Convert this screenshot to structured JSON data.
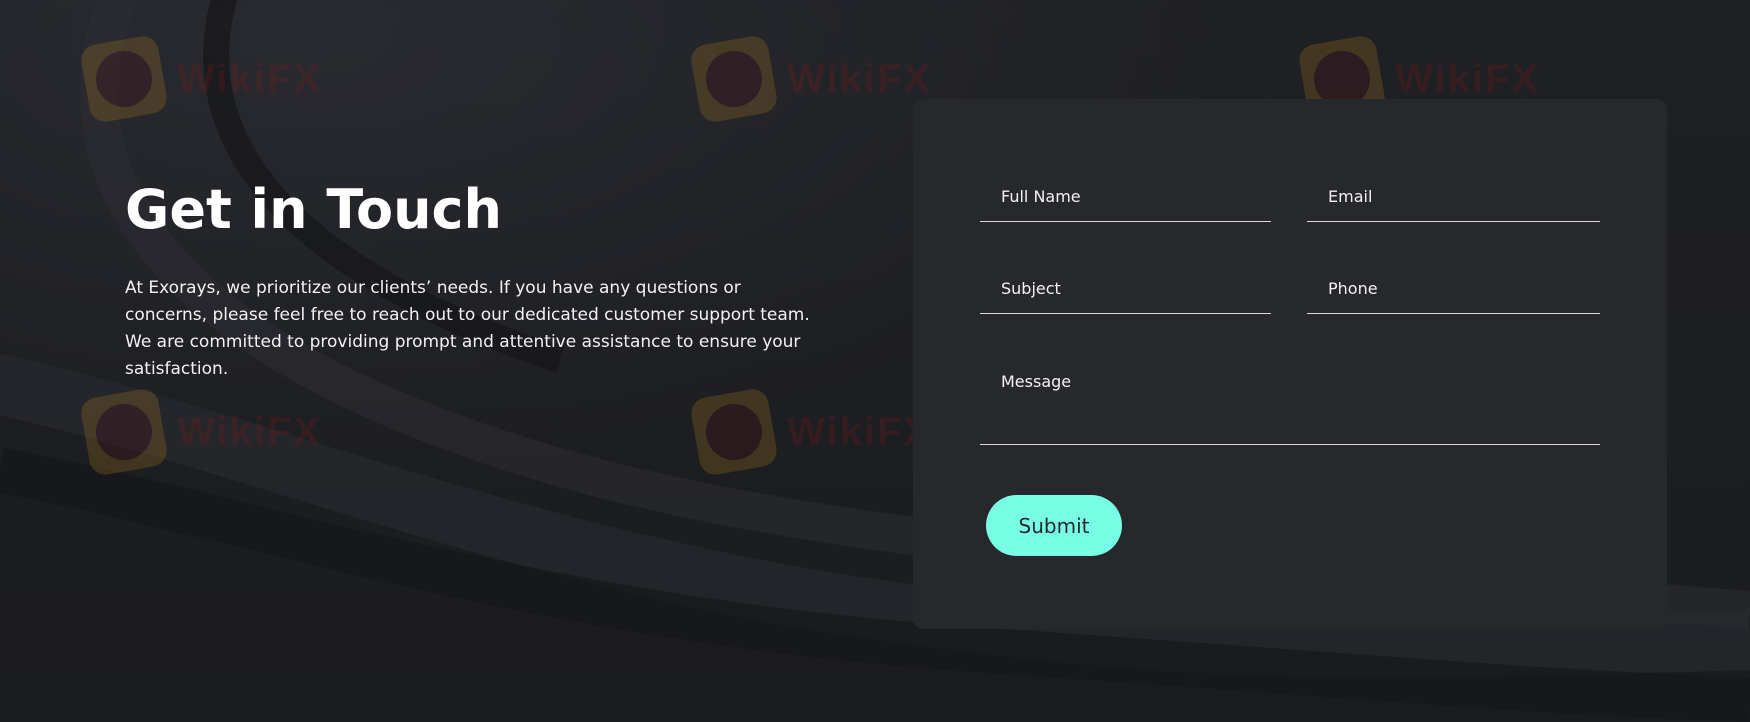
{
  "section": {
    "title": "Get in Touch",
    "description": "At Exorays, we prioritize our clients’ needs. If you have any questions or concerns, please feel free to reach out to our dedicated customer support team. We are committed to providing prompt and attentive assistance to ensure your satisfaction."
  },
  "form": {
    "fields": {
      "full_name": {
        "label": "Full Name",
        "value": ""
      },
      "email": {
        "label": "Email",
        "value": ""
      },
      "subject": {
        "label": "Subject",
        "value": ""
      },
      "phone": {
        "label": "Phone",
        "value": ""
      },
      "message": {
        "label": "Message",
        "value": ""
      }
    },
    "submit_label": "Submit"
  },
  "watermark": {
    "text": "WikiFX"
  },
  "colors": {
    "background": "#1c1d21",
    "card": "#27282c",
    "accent": "#78ffe6",
    "text": "#ffffff",
    "underline": "#d8d8d8"
  }
}
